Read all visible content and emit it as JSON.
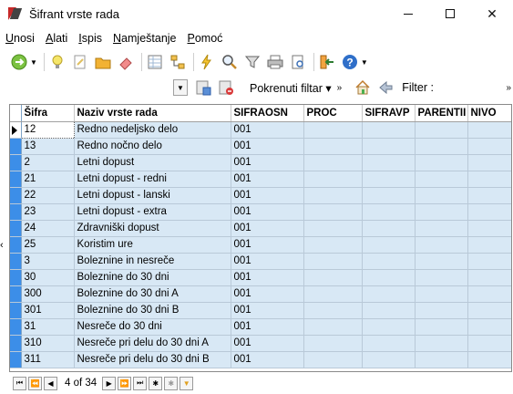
{
  "window": {
    "title": "Šifrant vrste rada"
  },
  "menu": [
    {
      "label": "Unosi",
      "accel": "U",
      "rest": "nosi"
    },
    {
      "label": "Alati",
      "accel": "A",
      "rest": "lati"
    },
    {
      "label": "Ispis",
      "accel": "I",
      "rest": "spis"
    },
    {
      "label": "Namještanje",
      "accel": "N",
      "rest": "amještanje"
    },
    {
      "label": "Pomoć",
      "accel": "P",
      "rest": "omoć"
    }
  ],
  "toolbar2": {
    "run_filter_label": "Pokrenuti filtar",
    "filter_label": "Filter :"
  },
  "grid": {
    "columns": [
      "Šifra",
      "Naziv vrste rada",
      "SIFRAOSN",
      "PROC",
      "SIFRAVP",
      "PARENTII",
      "NIVO"
    ],
    "rows": [
      [
        "12",
        "Redno nedeljsko delo",
        "001",
        "",
        "",
        "",
        ""
      ],
      [
        "13",
        "Redno nočno delo",
        "001",
        "",
        "",
        "",
        ""
      ],
      [
        "2",
        "Letni dopust",
        "001",
        "",
        "",
        "",
        ""
      ],
      [
        "21",
        "Letni dopust - redni",
        "001",
        "",
        "",
        "",
        ""
      ],
      [
        "22",
        "Letni dopust - lanski",
        "001",
        "",
        "",
        "",
        ""
      ],
      [
        "23",
        "Letni dopust - extra",
        "001",
        "",
        "",
        "",
        ""
      ],
      [
        "24",
        "Zdravniški dopust",
        "001",
        "",
        "",
        "",
        ""
      ],
      [
        "25",
        "Koristim ure",
        "001",
        "",
        "",
        "",
        ""
      ],
      [
        "3",
        "Boleznine in nesreče",
        "001",
        "",
        "",
        "",
        ""
      ],
      [
        "30",
        "Boleznine do 30 dni",
        "001",
        "",
        "",
        "",
        ""
      ],
      [
        "300",
        "Boleznine do 30 dni A",
        "001",
        "",
        "",
        "",
        ""
      ],
      [
        "301",
        "Boleznine do 30 dni B",
        "001",
        "",
        "",
        "",
        ""
      ],
      [
        "31",
        "Nesreče do 30 dni",
        "001",
        "",
        "",
        "",
        ""
      ],
      [
        "310",
        "Nesreče pri delu do 30 dni A",
        "001",
        "",
        "",
        "",
        ""
      ],
      [
        "311",
        "Nesreče pri delu do 30 dni B",
        "001",
        "",
        "",
        "",
        ""
      ]
    ]
  },
  "navigator": {
    "position": "4 of 34"
  },
  "colors": {
    "row_bg": "#d8e8f5",
    "row_header": "#3c8ee8"
  }
}
